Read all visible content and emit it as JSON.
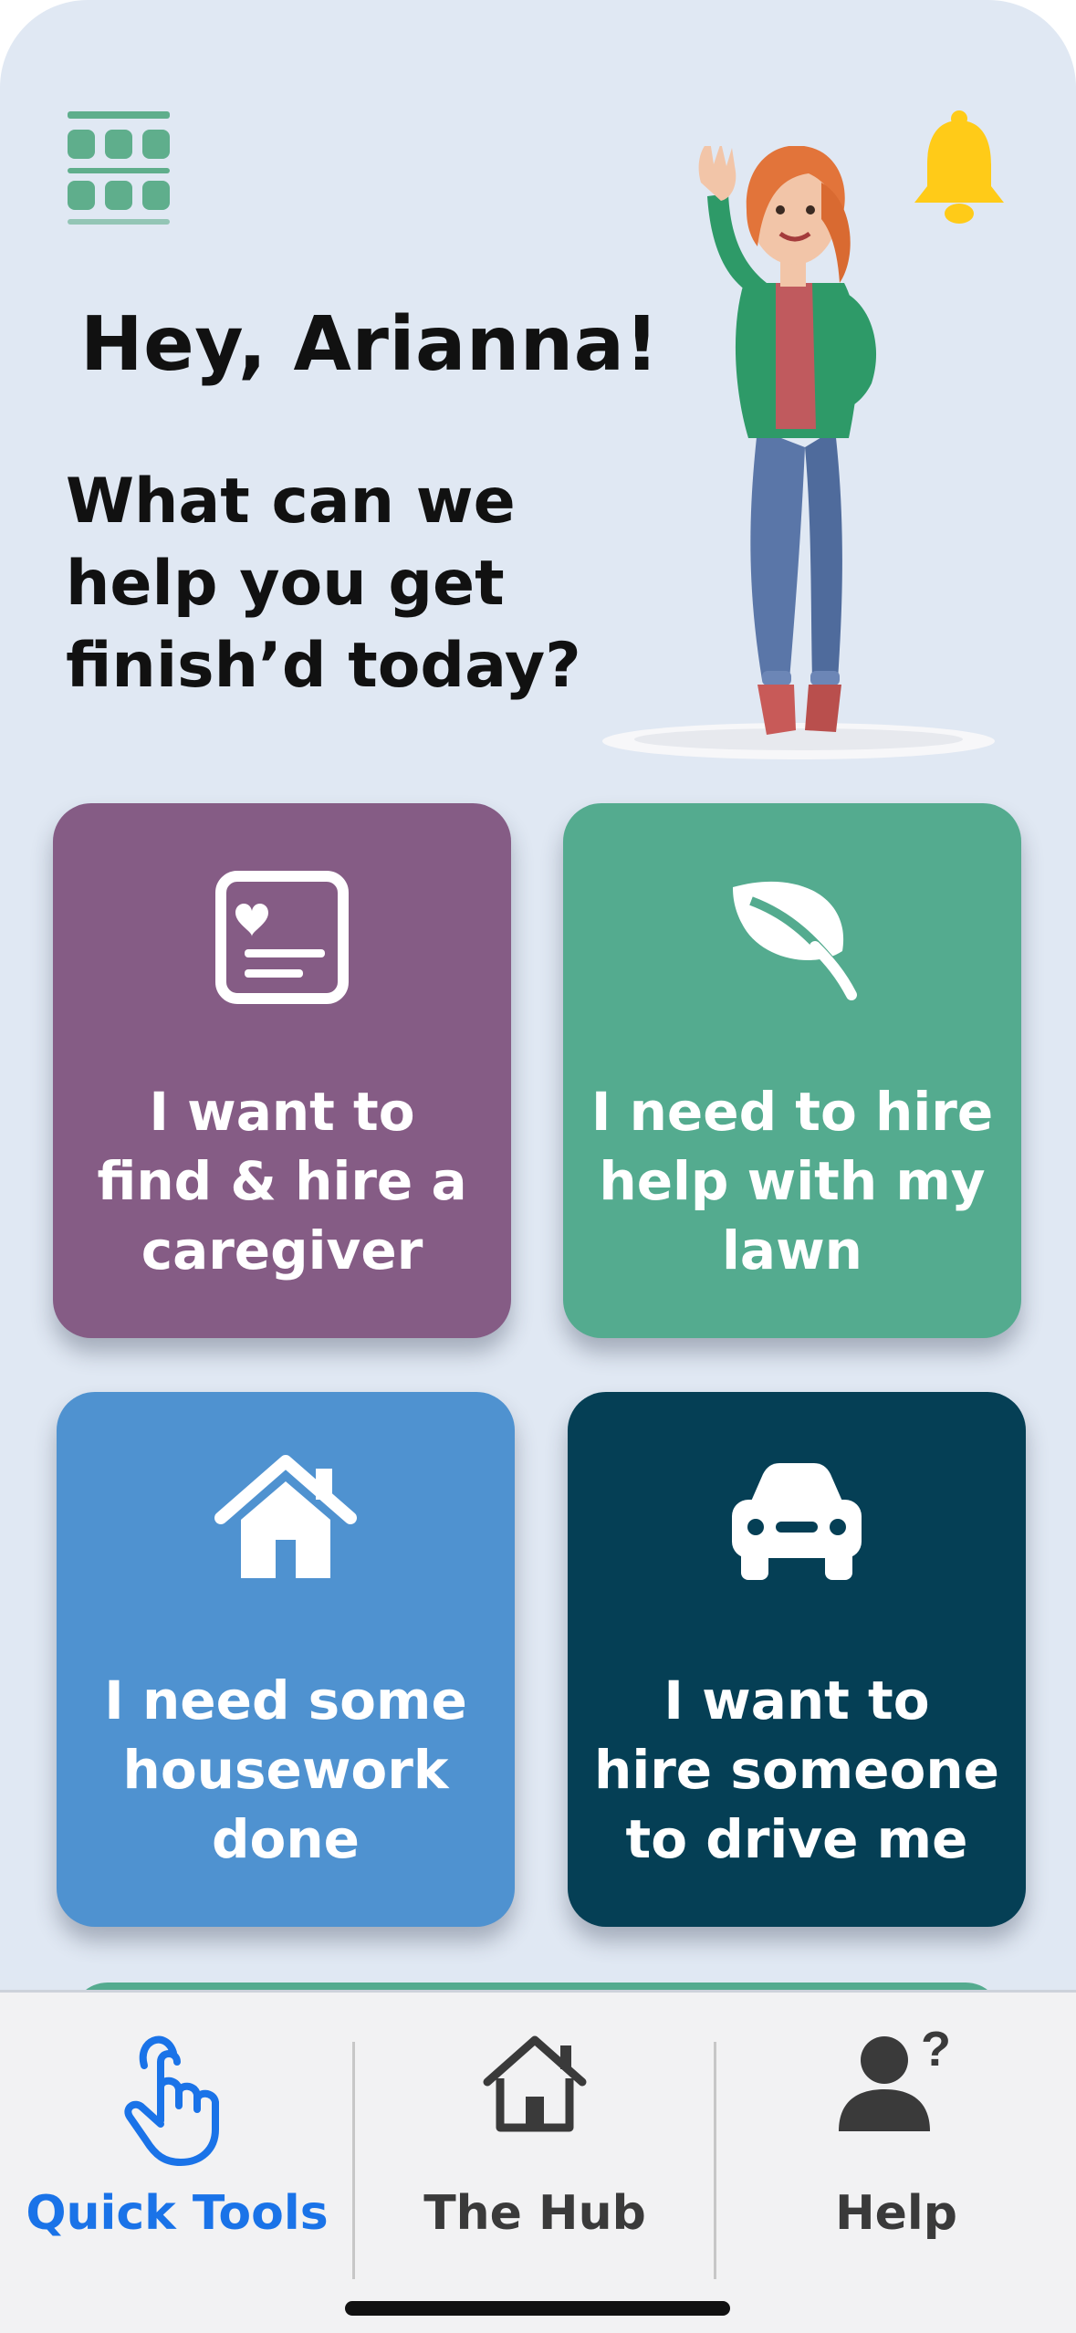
{
  "header": {
    "greeting": "Hey, Arianna!",
    "subheading": "What can we help you get finish’d today?",
    "menu_icon": "grid-menu-icon",
    "notification_icon": "bell-icon"
  },
  "colors": {
    "background": "#e0e8f3",
    "tile_caregiver": "#855c85",
    "tile_lawn": "#54ab8f",
    "tile_housework": "#4f92d0",
    "tile_driver": "#053f55",
    "accent_active": "#1a73e8",
    "bell": "#ffcb18",
    "menu_icon": "#5fae8c"
  },
  "tiles": [
    {
      "label": "I want to\nfind & hire a\ncaregiver",
      "icon": "caregiver-card-icon"
    },
    {
      "label": "I need to hire\nhelp with my\nlawn",
      "icon": "leaf-icon"
    },
    {
      "label": "I need some\nhousework\ndone",
      "icon": "house-icon"
    },
    {
      "label": "I want to\nhire someone\nto drive me",
      "icon": "car-icon"
    }
  ],
  "tabbar": {
    "tabs": [
      {
        "label": "Quick Tools",
        "icon": "tap-hand-icon",
        "active": true
      },
      {
        "label": "The Hub",
        "icon": "house-outline-icon",
        "active": false
      },
      {
        "label": "Help",
        "icon": "user-question-icon",
        "active": false
      }
    ]
  }
}
